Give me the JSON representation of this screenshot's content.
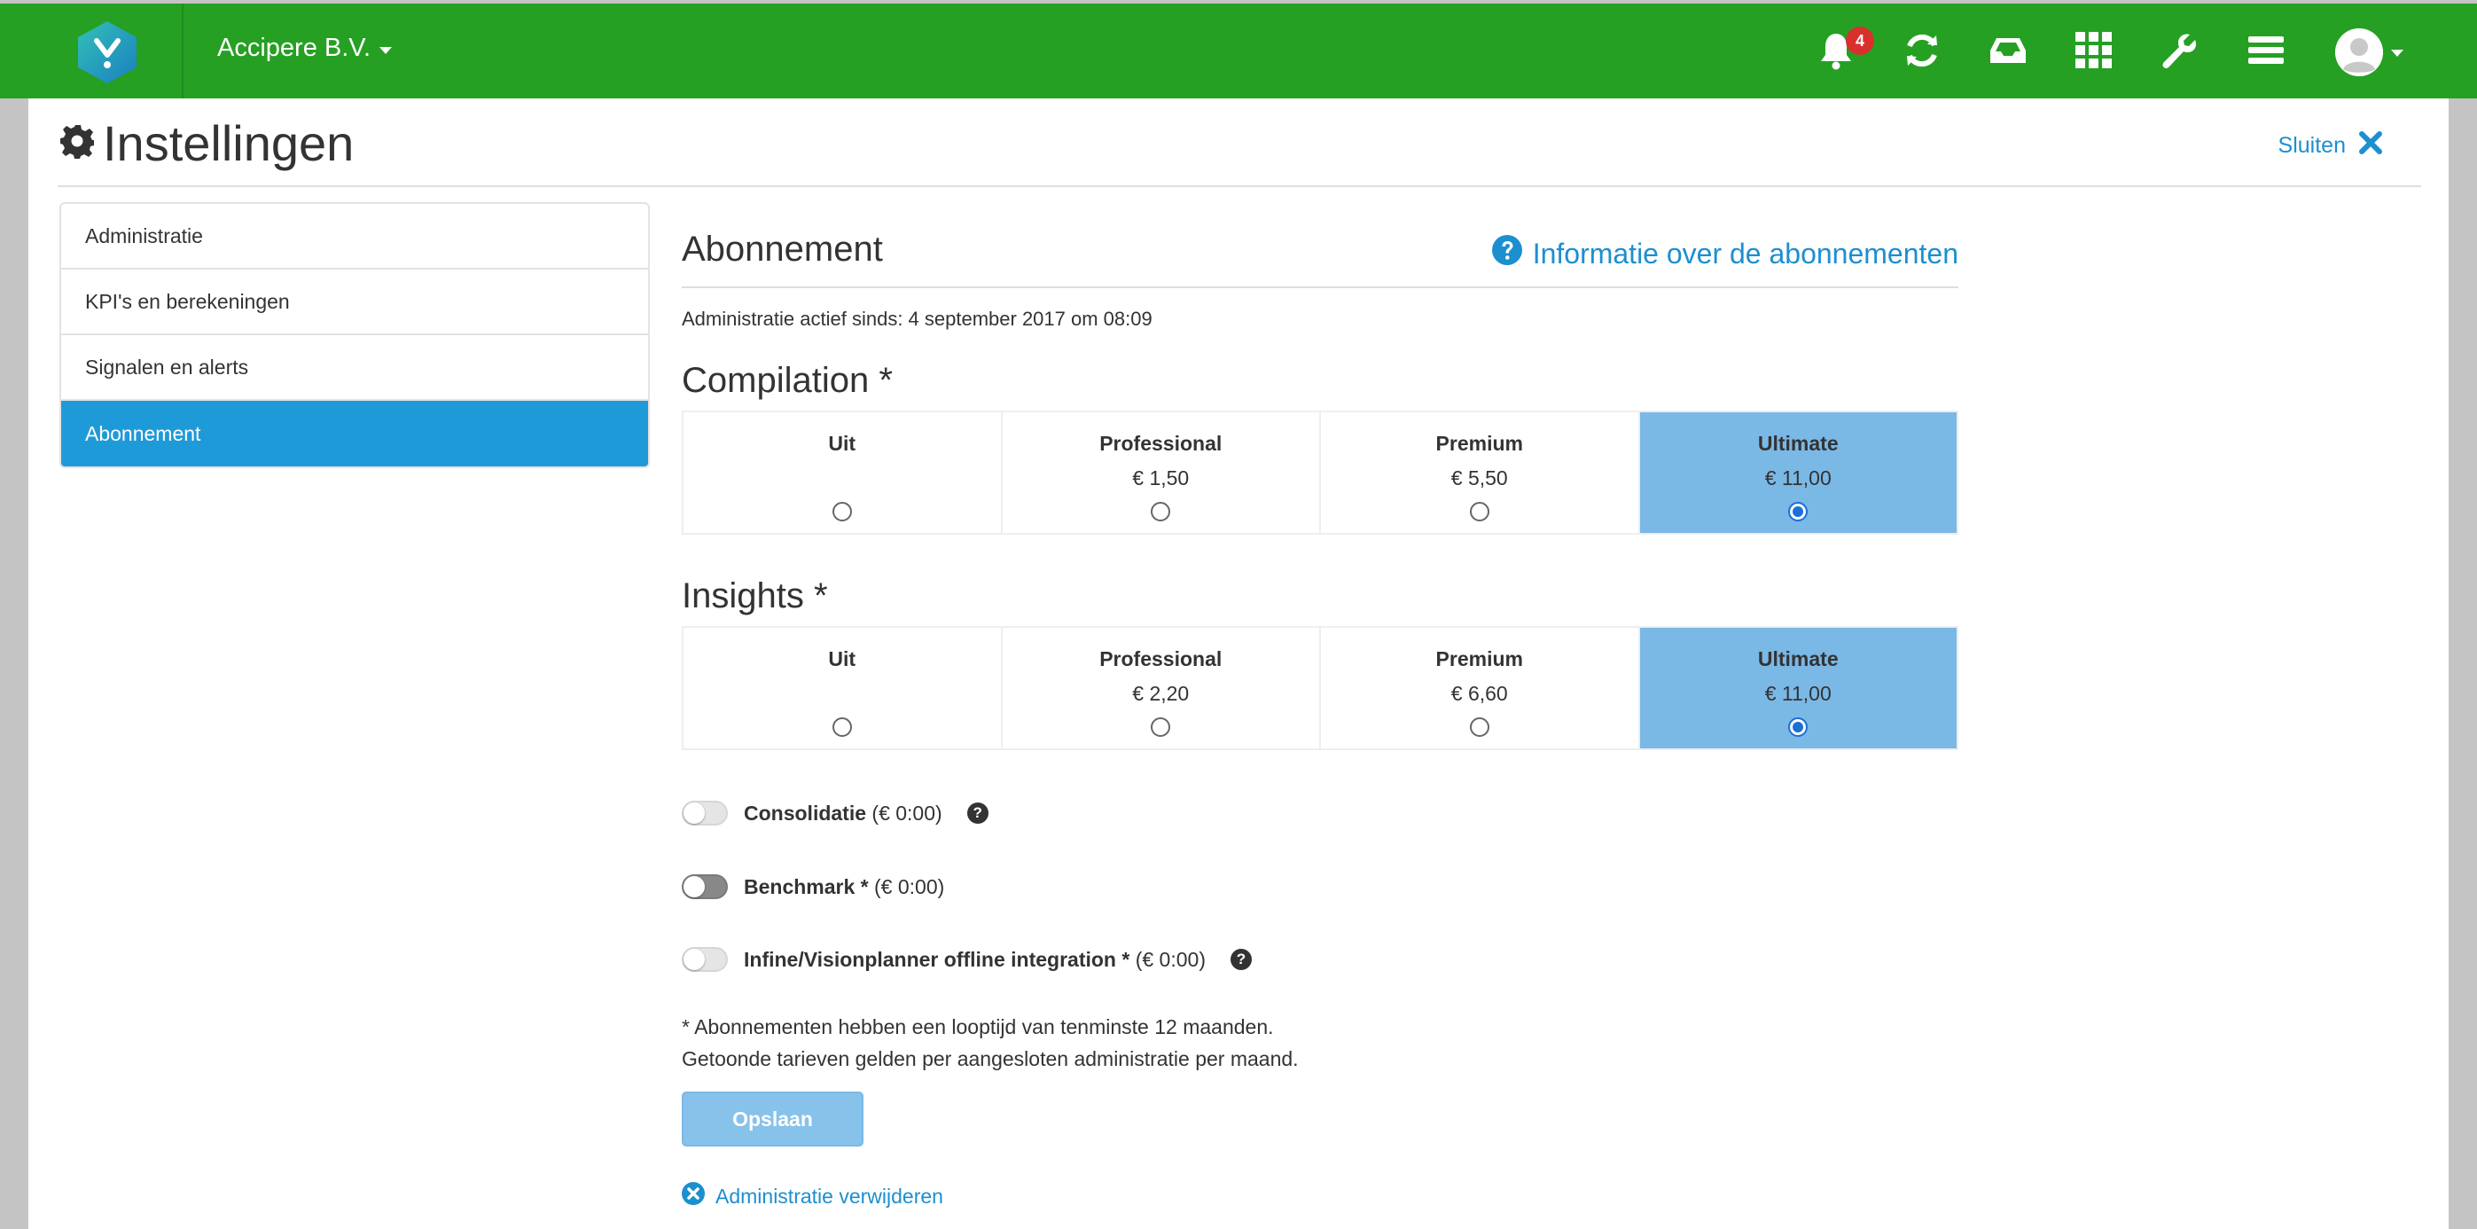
{
  "topbar": {
    "company": "Accipere B.V.",
    "notification_count": "4",
    "icons": [
      "bell-icon",
      "refresh-icon",
      "inbox-icon",
      "apps-grid-icon",
      "wrench-icon",
      "menu-icon",
      "user-avatar-icon"
    ],
    "color": "#25a023"
  },
  "page": {
    "title": "Instellingen",
    "close_label": "Sluiten"
  },
  "sidebar": {
    "items": [
      {
        "label": "Administratie"
      },
      {
        "label": "KPI's en berekeningen"
      },
      {
        "label": "Signalen en alerts"
      },
      {
        "label": "Abonnement"
      }
    ],
    "active": "Abonnement",
    "active_color": "#1f9ad8"
  },
  "main": {
    "heading": "Abonnement",
    "info_link": "Informatie over de abonnementen",
    "active_since": "Administratie actief sinds: 4 september 2017 om 08:09",
    "compilation": {
      "title": "Compilation *",
      "options": [
        {
          "name": "Uit",
          "price": ""
        },
        {
          "name": "Professional",
          "price": "€ 1,50"
        },
        {
          "name": "Premium",
          "price": "€ 5,50"
        },
        {
          "name": "Ultimate",
          "price": "€ 11,00"
        }
      ],
      "selected": "Ultimate"
    },
    "insights": {
      "title": "Insights *",
      "options": [
        {
          "name": "Uit",
          "price": ""
        },
        {
          "name": "Professional",
          "price": "€ 2,20"
        },
        {
          "name": "Premium",
          "price": "€ 6,60"
        },
        {
          "name": "Ultimate",
          "price": "€ 11,00"
        }
      ],
      "selected": "Ultimate"
    },
    "toggles": [
      {
        "label": "Consolidatie",
        "price": "(€ 0:00)",
        "on": false,
        "help": "?"
      },
      {
        "label": "Benchmark *",
        "price": "(€ 0:00)",
        "on": false,
        "help": ""
      },
      {
        "label": "Infine/Visionplanner offline integration *",
        "price": "(€ 0:00)",
        "on": false,
        "help": "?"
      }
    ],
    "note_line1": "* Abonnementen hebben een looptijd van tenminste 12 maanden.",
    "note_line2": "Getoonde tarieven gelden per aangesloten administratie per maand.",
    "save_label": "Opslaan",
    "delete_label": "Administratie verwijderen"
  }
}
